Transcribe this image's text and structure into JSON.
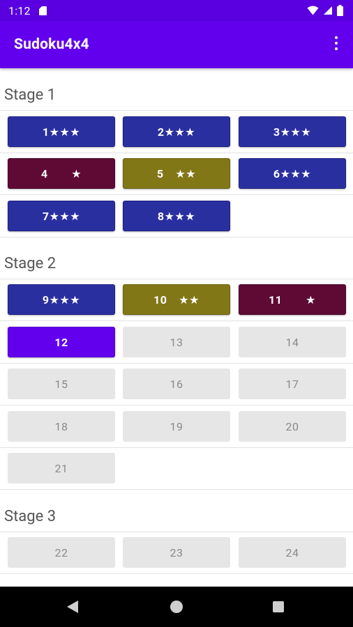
{
  "status": {
    "time": "1:12"
  },
  "appbar": {
    "title": "Sudoku4x4"
  },
  "stages": [
    {
      "title": "Stage 1"
    },
    {
      "title": "Stage 2"
    },
    {
      "title": "Stage 3"
    }
  ],
  "levels": [
    {
      "label": "1★★★",
      "state": "completed",
      "stars": 3,
      "color": "#2a2fa0"
    },
    {
      "label": "2★★★",
      "state": "completed",
      "stars": 3,
      "color": "#2a2fa0"
    },
    {
      "label": "3★★★",
      "state": "completed",
      "stars": 3,
      "color": "#2a2fa0"
    },
    {
      "label": "4  ★",
      "state": "completed",
      "stars": 1,
      "color": "#5e0a35"
    },
    {
      "label": "5 ★★",
      "state": "completed",
      "stars": 2,
      "color": "#827717"
    },
    {
      "label": "6★★★",
      "state": "completed",
      "stars": 3,
      "color": "#2a2fa0"
    },
    {
      "label": "7★★★",
      "state": "completed",
      "stars": 3,
      "color": "#2a2fa0"
    },
    {
      "label": "8★★★",
      "state": "completed",
      "stars": 3,
      "color": "#2a2fa0"
    },
    {
      "label": "9★★★",
      "state": "completed",
      "stars": 3,
      "color": "#2a2fa0"
    },
    {
      "label": "10 ★★",
      "state": "completed",
      "stars": 2,
      "color": "#827717"
    },
    {
      "label": "11  ★",
      "state": "completed",
      "stars": 1,
      "color": "#5e0a35"
    },
    {
      "label": "12",
      "state": "current",
      "color": "#6200ee"
    },
    {
      "label": "13",
      "state": "locked"
    },
    {
      "label": "14",
      "state": "locked"
    },
    {
      "label": "15",
      "state": "locked"
    },
    {
      "label": "16",
      "state": "locked"
    },
    {
      "label": "17",
      "state": "locked"
    },
    {
      "label": "18",
      "state": "locked"
    },
    {
      "label": "19",
      "state": "locked"
    },
    {
      "label": "20",
      "state": "locked"
    },
    {
      "label": "21",
      "state": "locked"
    },
    {
      "label": "22",
      "state": "locked"
    },
    {
      "label": "23",
      "state": "locked"
    },
    {
      "label": "24",
      "state": "locked"
    }
  ],
  "colors": {
    "statusbar": "#5a00e0",
    "appbar": "#6200ee",
    "three_star": "#2a2fa0",
    "two_star": "#827717",
    "one_star": "#5e0a35",
    "current": "#6200ee",
    "locked": "#e6e6e6"
  },
  "icons": {
    "status": [
      "sd-card-icon",
      "wifi-icon",
      "signal-icon",
      "battery-icon"
    ],
    "appbar": [
      "overflow-menu-icon"
    ],
    "navigation": [
      "back-icon",
      "home-icon",
      "recents-icon"
    ]
  }
}
